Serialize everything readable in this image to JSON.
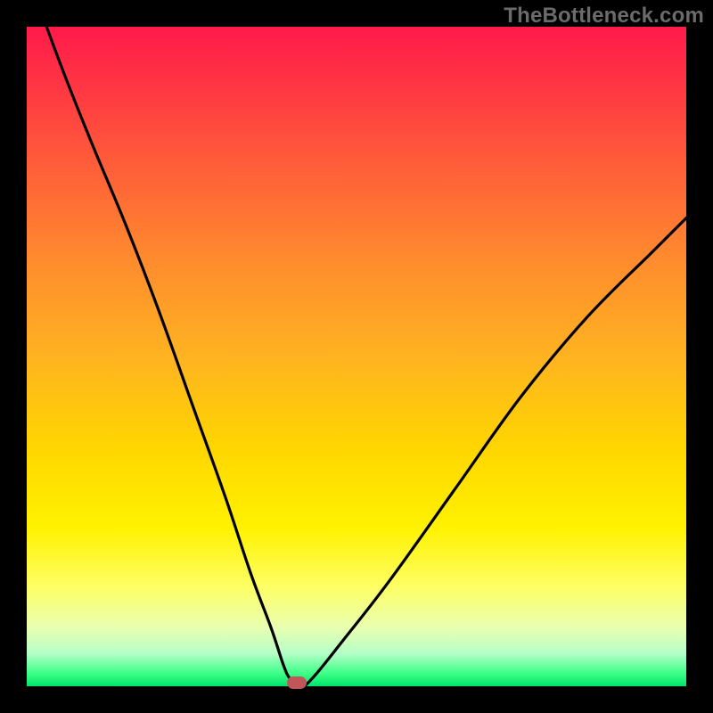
{
  "watermark": "TheBottleneck.com",
  "chart_data": {
    "type": "line",
    "title": "",
    "xlabel": "",
    "ylabel": "",
    "xlim": [
      0,
      100
    ],
    "ylim": [
      0,
      100
    ],
    "series": [
      {
        "name": "bottleneck-curve",
        "x": [
          3,
          6,
          10,
          15,
          20,
          25,
          30,
          34,
          37,
          39,
          40,
          41,
          42,
          44,
          48,
          55,
          65,
          75,
          85,
          95,
          100
        ],
        "values": [
          100,
          92,
          82,
          70,
          57,
          43,
          29,
          17,
          9,
          3,
          1,
          0,
          0,
          2,
          7,
          16,
          30,
          44,
          56,
          66,
          71
        ]
      }
    ],
    "marker": {
      "x": 41,
      "y": 0.5,
      "color": "#c0555a"
    },
    "gradient_stops": [
      {
        "pos": 0,
        "color": "#ff1a4a"
      },
      {
        "pos": 8,
        "color": "#ff3344"
      },
      {
        "pos": 20,
        "color": "#ff5a3a"
      },
      {
        "pos": 35,
        "color": "#ff8a2e"
      },
      {
        "pos": 50,
        "color": "#ffb321"
      },
      {
        "pos": 64,
        "color": "#ffd600"
      },
      {
        "pos": 76,
        "color": "#fff200"
      },
      {
        "pos": 85,
        "color": "#fdff66"
      },
      {
        "pos": 91,
        "color": "#eaffb0"
      },
      {
        "pos": 95,
        "color": "#b6ffc8"
      },
      {
        "pos": 98,
        "color": "#3fff88"
      },
      {
        "pos": 100,
        "color": "#00e46a"
      }
    ]
  }
}
